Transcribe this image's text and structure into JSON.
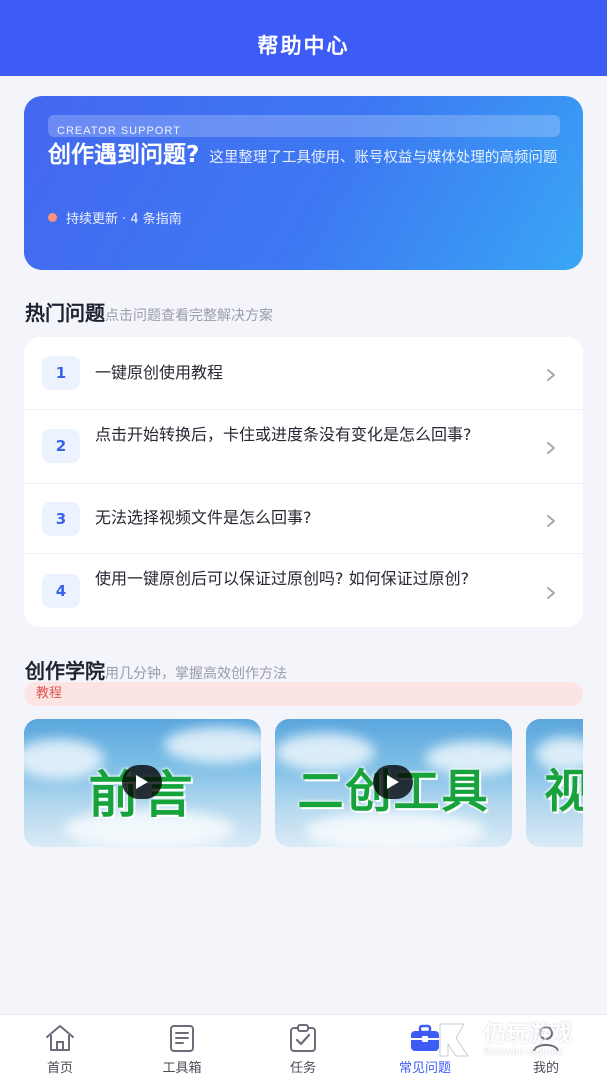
{
  "header": {
    "title": "帮助中心"
  },
  "hero": {
    "tag": "CREATOR SUPPORT",
    "headline": "创作遇到问题?",
    "description": "这里整理了工具使用、账号权益与媒体处理的高频问题",
    "status": "持续更新 · 4 条指南",
    "colors": {
      "gradient_start": "#4467f0",
      "gradient_end": "#39a6f5",
      "status_dot": "#ff8f7a"
    }
  },
  "faq": {
    "title": "热门问题",
    "subtitle": "点击问题查看完整解决方案",
    "items": [
      {
        "num": "1",
        "text": "一键原创使用教程"
      },
      {
        "num": "2",
        "text": "点击开始转换后，卡住或进度条没有变化是怎么回事?"
      },
      {
        "num": "3",
        "text": "无法选择视频文件是怎么回事?"
      },
      {
        "num": "4",
        "text": "使用一键原创后可以保证过原创吗? 如何保证过原创?"
      }
    ]
  },
  "academy": {
    "title": "创作学院",
    "subtitle": "用几分钟，掌握高效创作方法",
    "badge": "教程",
    "videos": [
      {
        "title": "前言",
        "icon": "play-icon"
      },
      {
        "title": "二创工具",
        "icon": "play-icon"
      },
      {
        "title": "视",
        "icon": "none"
      }
    ]
  },
  "tabbar": {
    "active_color": "#3d5cf5",
    "items": [
      {
        "label": "首页",
        "icon": "home-icon"
      },
      {
        "label": "工具箱",
        "icon": "toolbox-icon"
      },
      {
        "label": "任务",
        "icon": "task-icon"
      },
      {
        "label": "常见问题",
        "icon": "briefcase-icon",
        "active": true
      },
      {
        "label": "我的",
        "icon": "profile-icon"
      }
    ]
  },
  "watermark": {
    "text": "仍玩游戏",
    "sub": "Renwan Games"
  }
}
